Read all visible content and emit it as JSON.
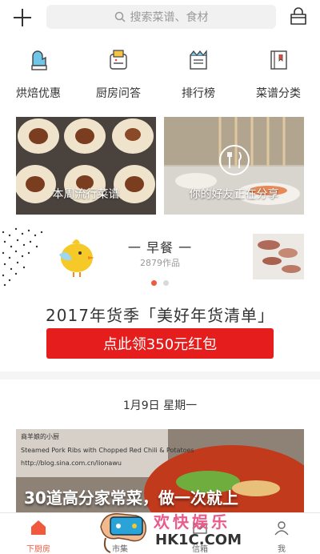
{
  "search": {
    "placeholder": "搜索菜谱、食材"
  },
  "quick_entries": [
    {
      "label": "烘焙优惠",
      "icon": "oven-mitt-icon"
    },
    {
      "label": "厨房问答",
      "icon": "toaster-icon"
    },
    {
      "label": "排行榜",
      "icon": "crown-book-icon"
    },
    {
      "label": "菜谱分类",
      "icon": "recipe-book-icon"
    }
  ],
  "banners": [
    {
      "caption": "本周流行菜谱"
    },
    {
      "caption": "你的好友正在分享"
    }
  ],
  "meal": {
    "title": "一 早餐 一",
    "count": "2879作品"
  },
  "promo": {
    "title": "2017年货季「美好年货清单」",
    "button": "点此领350元红包"
  },
  "feed": {
    "date": "1月9日 星期一",
    "caption": "30道高分家常菜，做一次就上",
    "overlay_lines": [
      "商羊娘的小厨",
      "Steamed Pork Ribs with Chopped Red Chili & Potatoes",
      "http://blog.sina.com.cn/lionawu"
    ]
  },
  "tabs": [
    {
      "label": "下厨房",
      "active": true
    },
    {
      "label": "市集",
      "active": false
    },
    {
      "label": "信箱",
      "active": false
    },
    {
      "label": "我",
      "active": false
    }
  ],
  "watermark": {
    "title": "欢快娱乐",
    "site": "HK1C.COM"
  },
  "colors": {
    "accent": "#f0593e",
    "promo_red": "#e51d1d"
  }
}
